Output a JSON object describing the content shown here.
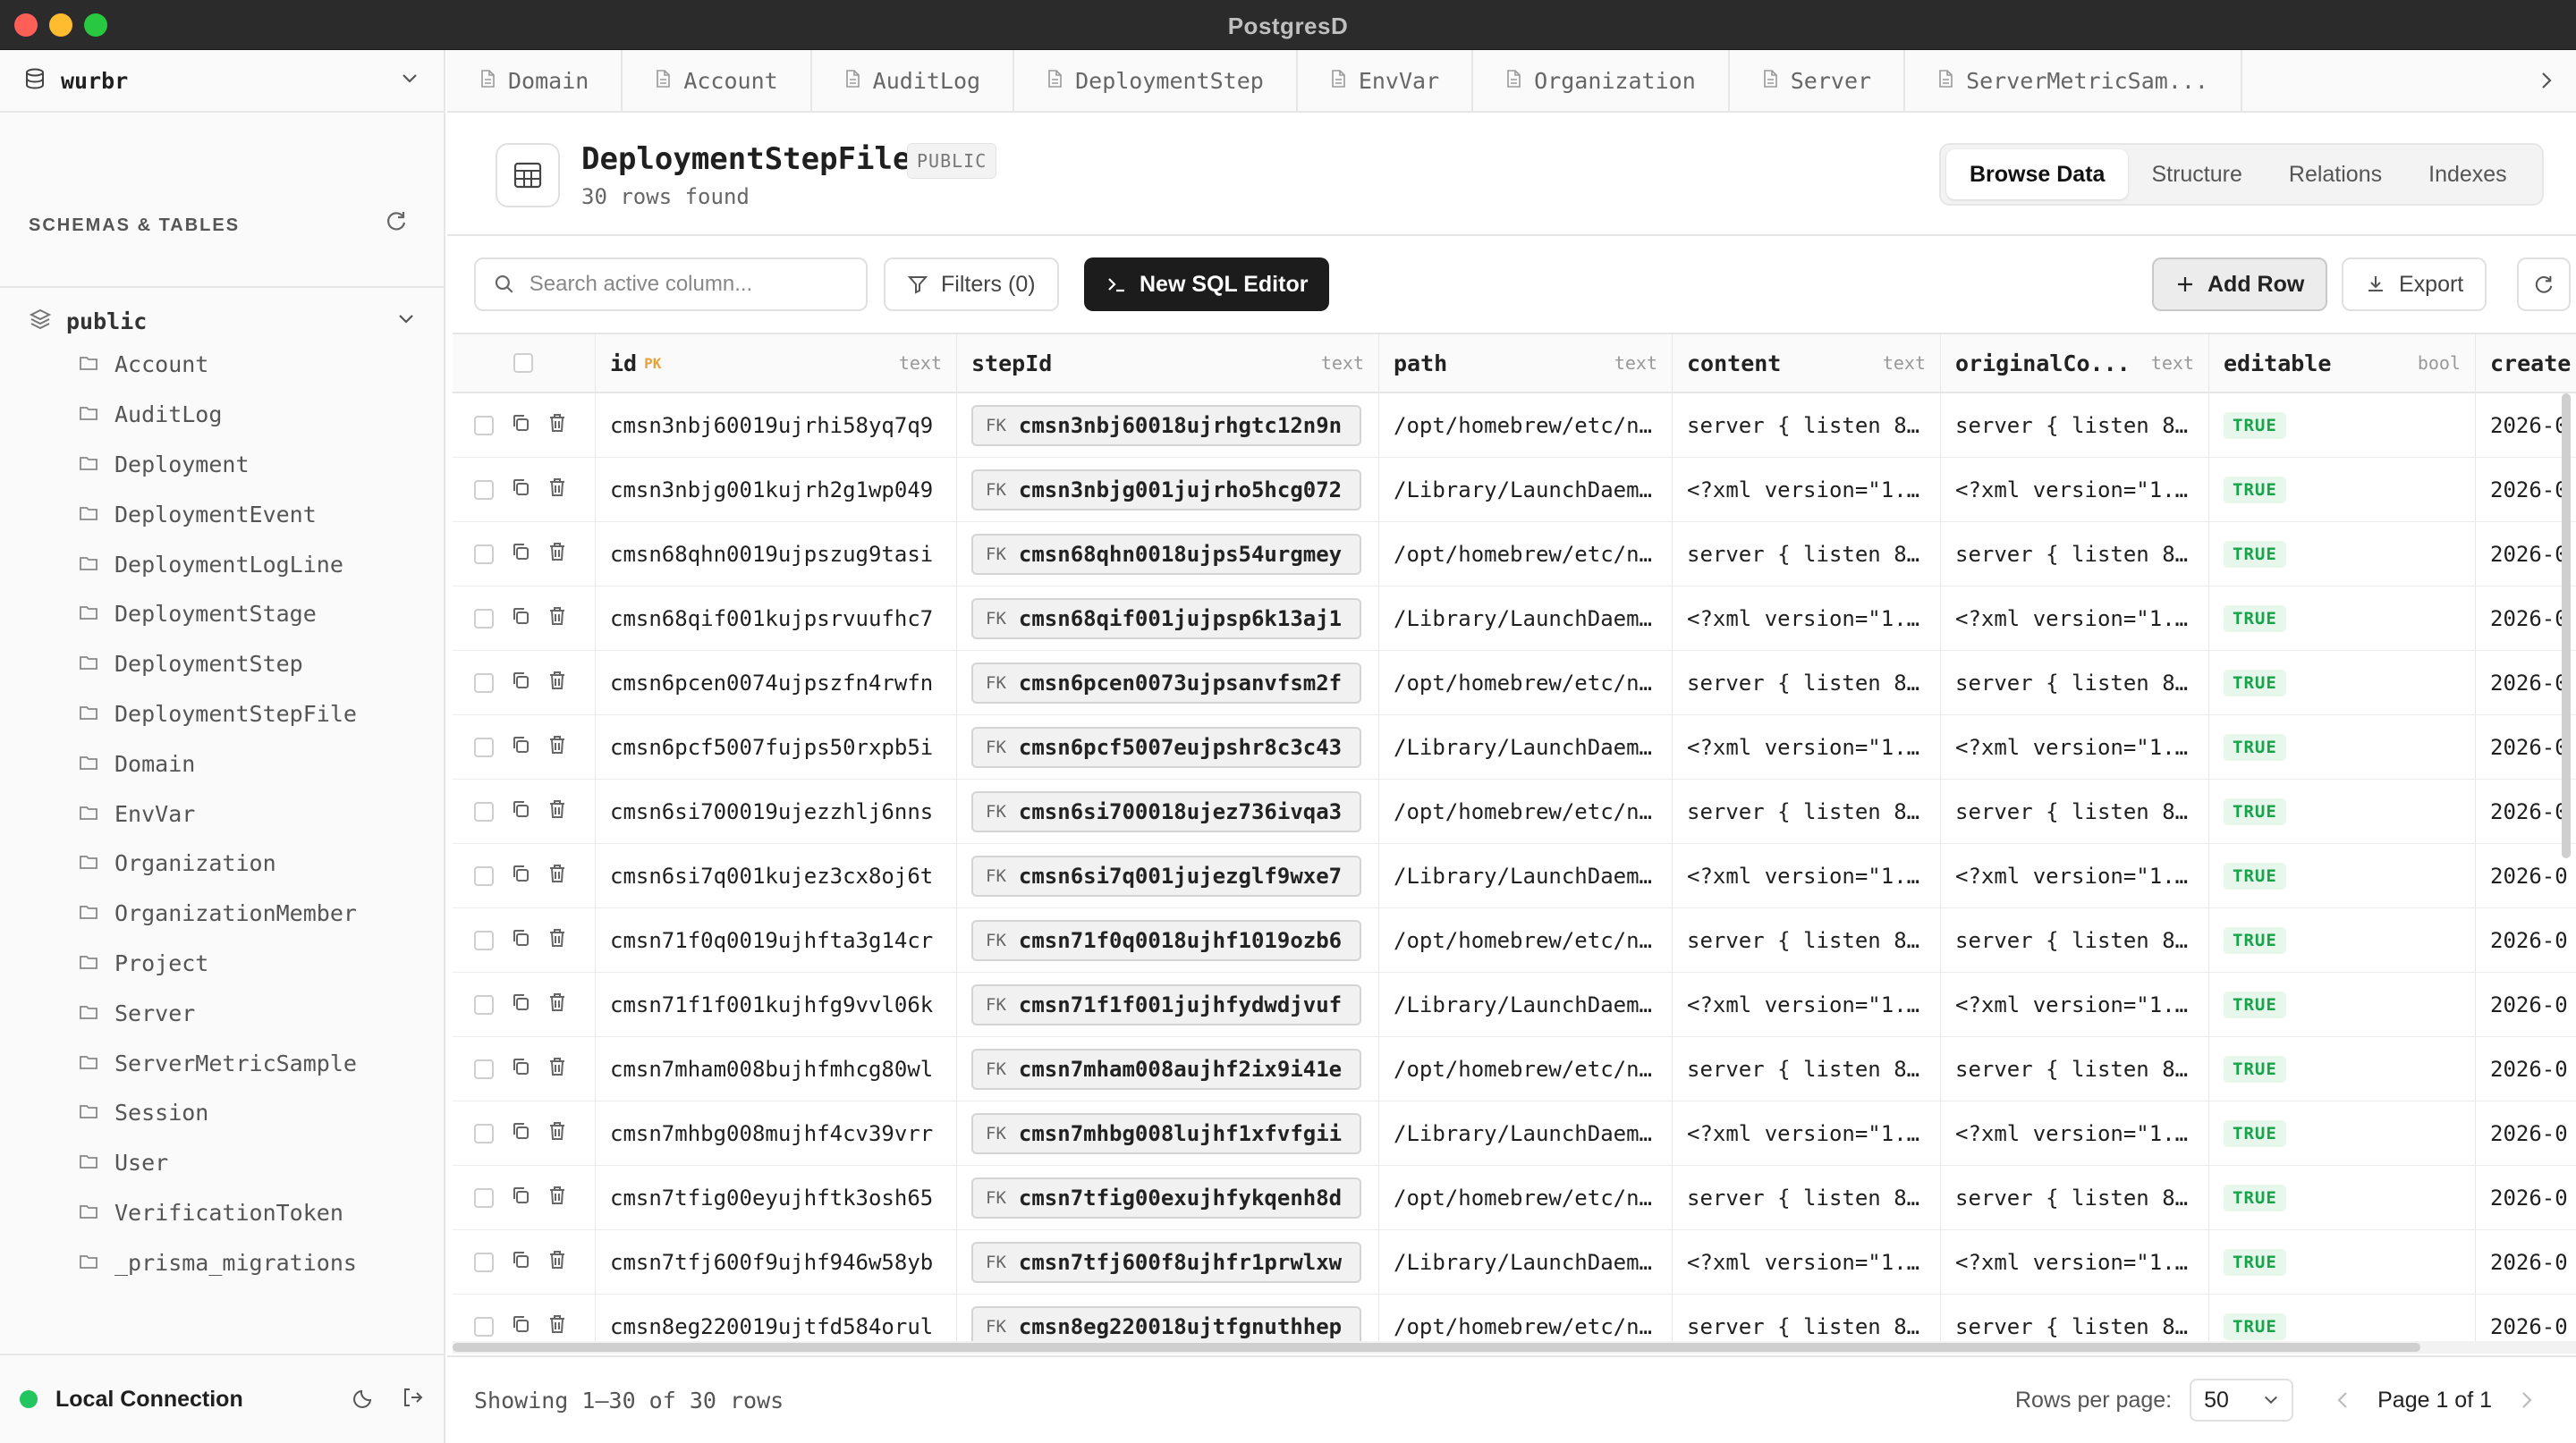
{
  "window": {
    "title": "PostgresD"
  },
  "sidebar": {
    "database": "wurbr",
    "section_label": "SCHEMAS & TABLES",
    "schema": "public",
    "tables": [
      "Account",
      "AuditLog",
      "Deployment",
      "DeploymentEvent",
      "DeploymentLogLine",
      "DeploymentStage",
      "DeploymentStep",
      "DeploymentStepFile",
      "Domain",
      "EnvVar",
      "Organization",
      "OrganizationMember",
      "Project",
      "Server",
      "ServerMetricSample",
      "Session",
      "User",
      "VerificationToken",
      "_prisma_migrations"
    ],
    "connection": "Local Connection"
  },
  "tabs": [
    "Domain",
    "Account",
    "AuditLog",
    "DeploymentStep",
    "EnvVar",
    "Organization",
    "Server",
    "ServerMetricSam..."
  ],
  "table_header": {
    "title": "DeploymentStepFile",
    "schema_badge": "PUBLIC",
    "rows_found": "30 rows found",
    "view_tabs": [
      "Browse Data",
      "Structure",
      "Relations",
      "Indexes"
    ]
  },
  "toolbar": {
    "search_placeholder": "Search active column...",
    "filters": "Filters (0)",
    "sql_editor": "New SQL Editor",
    "add_row": "Add Row",
    "export": "Export"
  },
  "columns": [
    {
      "name": "id",
      "tag": "PK",
      "type": "text"
    },
    {
      "name": "stepId",
      "type": "text"
    },
    {
      "name": "path",
      "type": "text"
    },
    {
      "name": "content",
      "type": "text"
    },
    {
      "name": "originalCo...",
      "type": "text"
    },
    {
      "name": "editable",
      "type": "bool"
    },
    {
      "name": "create"
    }
  ],
  "fk_label": "FK",
  "rows": [
    {
      "id": "cmsn3nbj60019ujrhi58yq7q9",
      "stepId": "cmsn3nbj60018ujrhgtc12n9n",
      "path": "/opt/homebrew/etc/n...",
      "content": "server { listen 8...",
      "original": "server { listen 8...",
      "editable": "TRUE",
      "created": "2026-0"
    },
    {
      "id": "cmsn3nbjg001kujrh2g1wp049",
      "stepId": "cmsn3nbjg001jujrho5hcg072",
      "path": "/Library/LaunchDaem...",
      "content": "<?xml version=\"1....",
      "original": "<?xml version=\"1....",
      "editable": "TRUE",
      "created": "2026-0"
    },
    {
      "id": "cmsn68qhn0019ujpszug9tasi",
      "stepId": "cmsn68qhn0018ujps54urgmey",
      "path": "/opt/homebrew/etc/n...",
      "content": "server { listen 8...",
      "original": "server { listen 8...",
      "editable": "TRUE",
      "created": "2026-0"
    },
    {
      "id": "cmsn68qif001kujpsrvuufhc7",
      "stepId": "cmsn68qif001jujpsp6k13aj1",
      "path": "/Library/LaunchDaem...",
      "content": "<?xml version=\"1....",
      "original": "<?xml version=\"1....",
      "editable": "TRUE",
      "created": "2026-0"
    },
    {
      "id": "cmsn6pcen0074ujpszfn4rwfn",
      "stepId": "cmsn6pcen0073ujpsanvfsm2f",
      "path": "/opt/homebrew/etc/n...",
      "content": "server { listen 8...",
      "original": "server { listen 8...",
      "editable": "TRUE",
      "created": "2026-0"
    },
    {
      "id": "cmsn6pcf5007fujps50rxpb5i",
      "stepId": "cmsn6pcf5007eujpshr8c3c43",
      "path": "/Library/LaunchDaem...",
      "content": "<?xml version=\"1....",
      "original": "<?xml version=\"1....",
      "editable": "TRUE",
      "created": "2026-0"
    },
    {
      "id": "cmsn6si700019ujezzhlj6nns",
      "stepId": "cmsn6si700018ujez736ivqa3",
      "path": "/opt/homebrew/etc/n...",
      "content": "server { listen 8...",
      "original": "server { listen 8...",
      "editable": "TRUE",
      "created": "2026-0"
    },
    {
      "id": "cmsn6si7q001kujez3cx8oj6t",
      "stepId": "cmsn6si7q001jujezglf9wxe7",
      "path": "/Library/LaunchDaem...",
      "content": "<?xml version=\"1....",
      "original": "<?xml version=\"1....",
      "editable": "TRUE",
      "created": "2026-0"
    },
    {
      "id": "cmsn71f0q0019ujhfta3g14cr",
      "stepId": "cmsn71f0q0018ujhf1019ozb6",
      "path": "/opt/homebrew/etc/n...",
      "content": "server { listen 8...",
      "original": "server { listen 8...",
      "editable": "TRUE",
      "created": "2026-0"
    },
    {
      "id": "cmsn71f1f001kujhfg9vvl06k",
      "stepId": "cmsn71f1f001jujhfydwdjvuf",
      "path": "/Library/LaunchDaem...",
      "content": "<?xml version=\"1....",
      "original": "<?xml version=\"1....",
      "editable": "TRUE",
      "created": "2026-0"
    },
    {
      "id": "cmsn7mham008bujhfmhcg80wl",
      "stepId": "cmsn7mham008aujhf2ix9i41e",
      "path": "/opt/homebrew/etc/n...",
      "content": "server { listen 8...",
      "original": "server { listen 8...",
      "editable": "TRUE",
      "created": "2026-0"
    },
    {
      "id": "cmsn7mhbg008mujhf4cv39vrr",
      "stepId": "cmsn7mhbg008lujhf1xfvfgii",
      "path": "/Library/LaunchDaem...",
      "content": "<?xml version=\"1....",
      "original": "<?xml version=\"1....",
      "editable": "TRUE",
      "created": "2026-0"
    },
    {
      "id": "cmsn7tfig00eyujhftk3osh65",
      "stepId": "cmsn7tfig00exujhfykqenh8d",
      "path": "/opt/homebrew/etc/n...",
      "content": "server { listen 8...",
      "original": "server { listen 8...",
      "editable": "TRUE",
      "created": "2026-0"
    },
    {
      "id": "cmsn7tfj600f9ujhf946w58yb",
      "stepId": "cmsn7tfj600f8ujhfr1prwlxw",
      "path": "/Library/LaunchDaem...",
      "content": "<?xml version=\"1....",
      "original": "<?xml version=\"1....",
      "editable": "TRUE",
      "created": "2026-0"
    },
    {
      "id": "cmsn8eg220019ujtfd584orul",
      "stepId": "cmsn8eg220018ujtfgnuthhep",
      "path": "/opt/homebrew/etc/n...",
      "content": "server { listen 8...",
      "original": "server { listen 8...",
      "editable": "TRUE",
      "created": "2026-0"
    }
  ],
  "footer": {
    "showing": "Showing 1–30 of 30 rows",
    "rows_per_page_label": "Rows per page:",
    "rows_per_page": "50",
    "page": "Page 1 of 1"
  },
  "colors": {
    "status": "#22c55e",
    "true_badge": "#16a34a",
    "pk": "#e6a23c"
  },
  "icons": {
    "db": "database-icon",
    "chevron": "chevron-down-icon",
    "refresh": "refresh-icon",
    "layers": "layers-icon",
    "folder": "folder-icon",
    "file": "file-icon",
    "table": "table-grid-icon",
    "search": "search-icon",
    "filter": "filter-icon",
    "terminal": "terminal-icon",
    "plus": "plus-icon",
    "download": "download-icon",
    "copy": "copy-icon",
    "trash": "trash-icon",
    "moon": "moon-icon",
    "logout": "logout-icon"
  }
}
